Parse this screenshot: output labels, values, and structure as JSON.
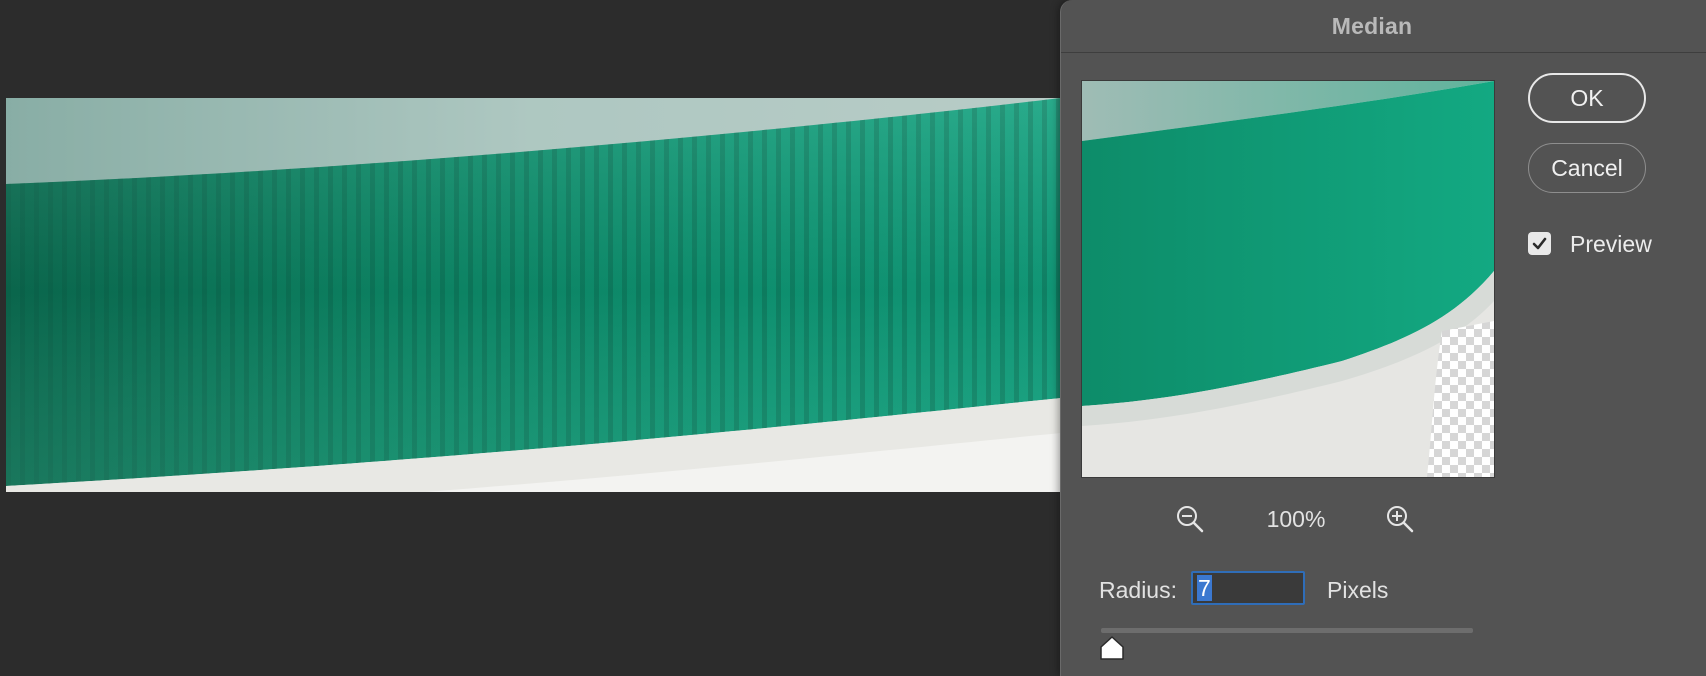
{
  "dialog": {
    "title": "Median",
    "ok_label": "OK",
    "cancel_label": "Cancel",
    "preview_label": "Preview",
    "preview_checked": true,
    "zoom_level": "100%",
    "radius_label": "Radius:",
    "radius_value": "7",
    "units_label": "Pixels",
    "slider_value": 7
  },
  "icons": {
    "zoom_out": "zoom-out-icon",
    "zoom_in": "zoom-in-icon",
    "checkmark": "checkmark-icon",
    "slider_thumb": "slider-thumb-icon"
  },
  "colors": {
    "workspace_bg": "#2c2c2c",
    "dialog_bg": "#535353",
    "input_focus": "#2f6db8",
    "photo_green": "#0c9f7c",
    "photo_white": "#e9e9e6"
  }
}
